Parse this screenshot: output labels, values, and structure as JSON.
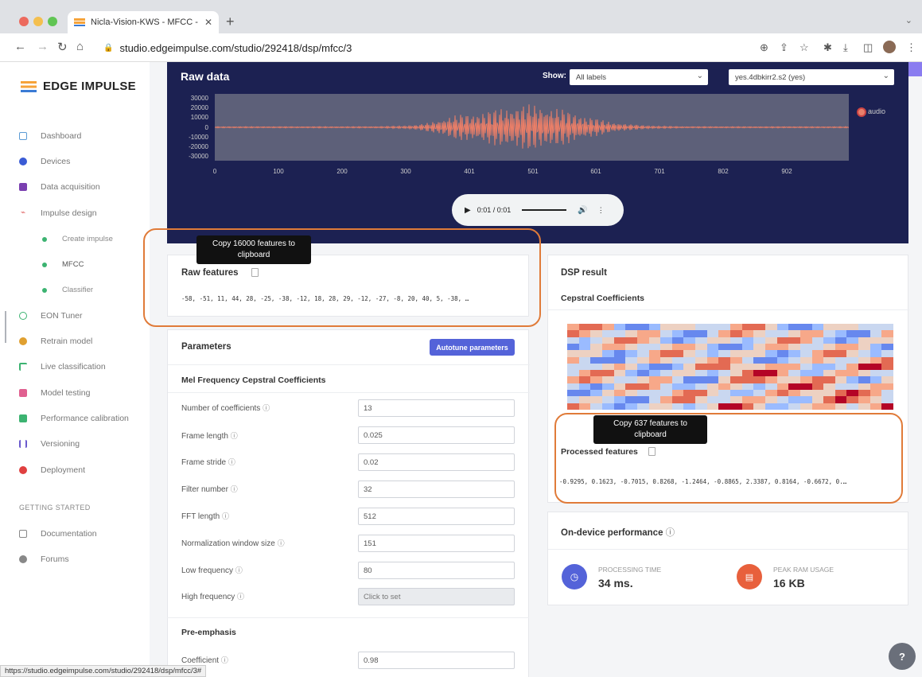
{
  "browser": {
    "tab_title": "Nicla-Vision-KWS - MFCC - E",
    "url": "studio.edgeimpulse.com/studio/292418/dsp/mfcc/3",
    "status_url": "https://studio.edgeimpulse.com/studio/292418/dsp/mfcc/3#"
  },
  "sidebar": {
    "brand": "EDGE IMPULSE",
    "items": [
      {
        "label": "Dashboard",
        "icon": "dashboard-icon",
        "color": "#5b9bd5"
      },
      {
        "label": "Devices",
        "icon": "devices-icon",
        "color": "#3a5bd5"
      },
      {
        "label": "Data acquisition",
        "icon": "database-icon",
        "color": "#7a3fb0"
      },
      {
        "label": "Impulse design",
        "icon": "impulse-icon",
        "color": "#e06060"
      },
      {
        "label": "EON Tuner",
        "icon": "tuner-icon",
        "color": "#3cb371"
      },
      {
        "label": "Retrain model",
        "icon": "retrain-icon",
        "color": "#e0a030"
      },
      {
        "label": "Live classification",
        "icon": "live-icon",
        "color": "#3cb371"
      },
      {
        "label": "Model testing",
        "icon": "testing-icon",
        "color": "#e06090"
      },
      {
        "label": "Performance calibration",
        "icon": "calibration-icon",
        "color": "#3cb371"
      },
      {
        "label": "Versioning",
        "icon": "versioning-icon",
        "color": "#6a5acd"
      },
      {
        "label": "Deployment",
        "icon": "deployment-icon",
        "color": "#e04040"
      }
    ],
    "sub_items": [
      {
        "label": "Create impulse"
      },
      {
        "label": "MFCC"
      },
      {
        "label": "Classifier"
      }
    ],
    "section_label": "GETTING STARTED",
    "getting_started": [
      {
        "label": "Documentation",
        "icon": "documentation-icon"
      },
      {
        "label": "Forums",
        "icon": "forums-icon"
      }
    ]
  },
  "raw_data": {
    "title": "Raw data",
    "show_label": "Show:",
    "label_filter": "All labels",
    "sample_select": "yes.4dbkirr2.s2 (yes)",
    "y_ticks": [
      "30000",
      "20000",
      "10000",
      "0",
      "-10000",
      "-20000",
      "-30000"
    ],
    "x_ticks": [
      "0",
      "100",
      "200",
      "300",
      "401",
      "501",
      "601",
      "701",
      "802",
      "902"
    ],
    "legend": "audio",
    "series_color": "#ee7f67",
    "audio_time": "0:01 / 0:01"
  },
  "raw_features": {
    "title": "Raw features",
    "tooltip": "Copy 16000 features to clipboard",
    "values": "-58, -51, 11, 44, 28, -25, -38, -12, 18, 28, 29, -12, -27, -8, 20, 40, 5, -38, …"
  },
  "parameters": {
    "title": "Parameters",
    "autotune_label": "Autotune parameters",
    "mfcc_heading": "Mel Frequency Cepstral Coefficients",
    "fields": [
      {
        "label": "Number of coefficients",
        "value": "13"
      },
      {
        "label": "Frame length",
        "value": "0.025"
      },
      {
        "label": "Frame stride",
        "value": "0.02"
      },
      {
        "label": "Filter number",
        "value": "32"
      },
      {
        "label": "FFT length",
        "value": "512"
      },
      {
        "label": "Normalization window size",
        "value": "151"
      },
      {
        "label": "Low frequency",
        "value": "80"
      },
      {
        "label": "High frequency",
        "value": "",
        "placeholder": "Click to set"
      }
    ],
    "pre_emphasis_heading": "Pre-emphasis",
    "coefficient_label": "Coefficient",
    "coefficient_value": "0.98"
  },
  "dsp_result": {
    "title": "DSP result",
    "subtitle": "Cepstral Coefficients",
    "processed_title": "Processed features",
    "tooltip": "Copy 637 features to clipboard",
    "values": "-0.9295, 0.1623, -0.7015, 0.8268, -1.2464, -0.8865, 2.3387, 0.8164, -0.6672, 0.…"
  },
  "performance": {
    "title": "On-device performance",
    "processing_label": "PROCESSING TIME",
    "processing_value": "34 ms.",
    "ram_label": "PEAK RAM USAGE",
    "ram_value": "16 KB",
    "processing_color": "#5463d9",
    "ram_color": "#e8603c"
  },
  "help_label": "?"
}
